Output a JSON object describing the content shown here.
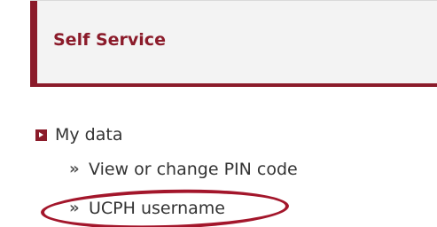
{
  "panel": {
    "title": "Self Service"
  },
  "menu": {
    "section_label": "My data",
    "items": [
      {
        "label": "View or change PIN code"
      },
      {
        "label": "UCPH username"
      }
    ]
  },
  "colors": {
    "accent": "#8b1b2a",
    "highlight_oval": "#a3162b",
    "text": "#333333",
    "header_bg": "#f3f3f3"
  },
  "icons": {
    "section_icon": "arrow-square-icon",
    "item_icon": "double-chevron-right-icon"
  }
}
